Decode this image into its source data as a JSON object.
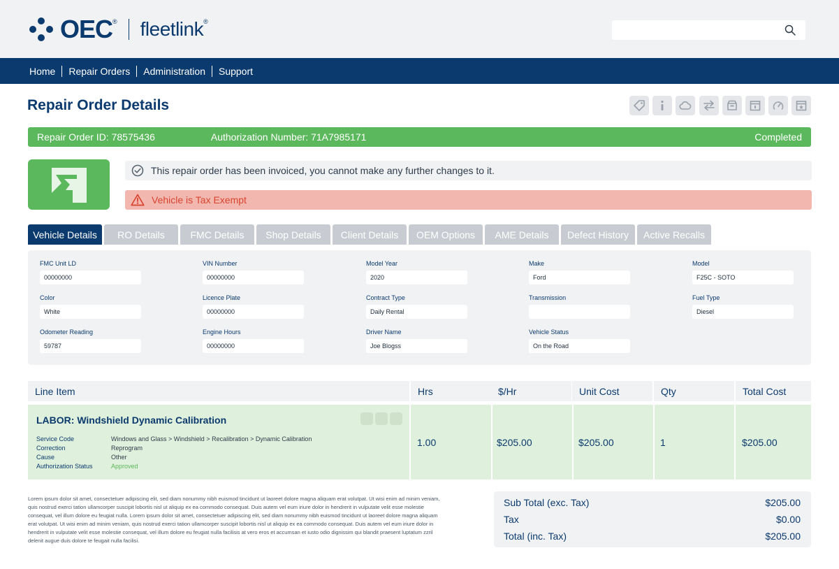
{
  "header": {
    "brand_primary": "OEC",
    "brand_secondary": "fleetlink",
    "search_placeholder": ""
  },
  "nav": [
    "Home",
    "Repair Orders",
    "Administration",
    "Support"
  ],
  "page": {
    "title": "Repair Order Details"
  },
  "toolbar": {
    "icons": [
      "tag-icon",
      "info-icon",
      "cloud-icon",
      "transfer-icon",
      "archive-icon",
      "calendar-icon",
      "gauge-icon",
      "star-calendar-icon"
    ]
  },
  "status_bar": {
    "ro_id": "Repair Order ID: 78575436",
    "authorization": "Authorization Number: 71A7985171",
    "state": "Completed"
  },
  "messages": {
    "notice": "This repair order has been invoiced, you cannot make any further changes to it.",
    "alert": "Vehicle is Tax Exempt"
  },
  "tabs": [
    "Vehicle Details",
    "RO Details",
    "FMC Details",
    "Shop Details",
    "Client Details",
    "OEM Options",
    "AME Details",
    "Defect History",
    "Active Recalls"
  ],
  "vehicle": {
    "fmc_unit": {
      "label": "FMC Unit LD",
      "value": "00000000"
    },
    "vin": {
      "label": "VIN Number",
      "value": "00000000"
    },
    "model_year": {
      "label": "Model Year",
      "value": "2020"
    },
    "make": {
      "label": "Make",
      "value": "Ford"
    },
    "model": {
      "label": "Model",
      "value": "F25C - SOTO"
    },
    "color": {
      "label": "Color",
      "value": "White"
    },
    "licence": {
      "label": "Licence Plate",
      "value": "00000000"
    },
    "contract": {
      "label": "Contract Type",
      "value": "Daily Rental"
    },
    "transmission": {
      "label": "Transmission",
      "value": ""
    },
    "fuel": {
      "label": "Fuel Type",
      "value": "Diesel"
    },
    "odometer": {
      "label": "Odometer Reading",
      "value": "59787"
    },
    "engine_hours": {
      "label": "Engine Hours",
      "value": "00000000"
    },
    "driver": {
      "label": "Driver Name",
      "value": "Joe Blogss"
    },
    "vehicle_status": {
      "label": "Vehicle Status",
      "value": "On the Road"
    }
  },
  "line_items": {
    "headers": {
      "item": "Line Item",
      "hrs": "Hrs",
      "rate": "$/Hr",
      "unit_cost": "Unit Cost",
      "qty": "Qty",
      "total": "Total Cost"
    },
    "rows": [
      {
        "title": "LABOR: Windshield Dynamic Calibration",
        "service_code_label": "Service Code",
        "service_code": "Windows and Glass > Windshield > Recalibration > Dynamic Calibration",
        "correction_label": "Correction",
        "correction": "Reprogram",
        "cause_label": "Cause",
        "cause": "Other",
        "auth_label": "Authorization Status",
        "auth": "Approved",
        "hrs": "1.00",
        "rate": "$205.00",
        "unit_cost": "$205.00",
        "qty": "1",
        "total": "$205.00"
      }
    ]
  },
  "footer": {
    "lorem": "Lorem ipsum dolor sit amet, consectetuer adipiscing elit, sed diam nonummy nibh euismod tincidunt ut laoreet dolore magna aliquam erat volutpat. Ut wisi enim ad minim veniam, quis nostrud exerci tation ullamcorper suscipit lobortis nisl ut aliquip ex ea commodo consequat. Duis autem vel eum iriure dolor in hendrerit in vulputate velit esse molestie consequat, vel illum dolore eu feugiat nulla. Lorem ipsum dolor sit amet, consectetuer adipiscing elit, sed diam nonummy nibh euismod tincidunt ut laoreet dolore magna aliquam erat volutpat. Ut wisi enim ad minim veniam, quis nostrud exerci tation ullamcorper suscipit lobortis nisl ut aliquip ex ea commodo consequat. Duis autem vel eum iriure dolor in hendrerit in vulputate velit esse molestie consequat, vel illum dolore eu feugiat nulla facilisis at vero eros et accumsan et iusto odio dignissim qui blandit praesent luptatum zzril delenit augue duis dolore te feugait nulla facilisi.",
    "totals": {
      "subtotal_label": "Sub Total (exc. Tax)",
      "subtotal": "$205.00",
      "tax_label": "Tax",
      "tax": "$0.00",
      "total_label": "Total (inc. Tax)",
      "total": "$205.00"
    }
  },
  "colors": {
    "brand_navy": "#0b3a6e",
    "success_green": "#5cb85c",
    "row_green": "#dff0dc",
    "alert_red": "#d9432f",
    "alert_bg": "#f2b8b0",
    "panel_grey": "#f1f2f4"
  }
}
